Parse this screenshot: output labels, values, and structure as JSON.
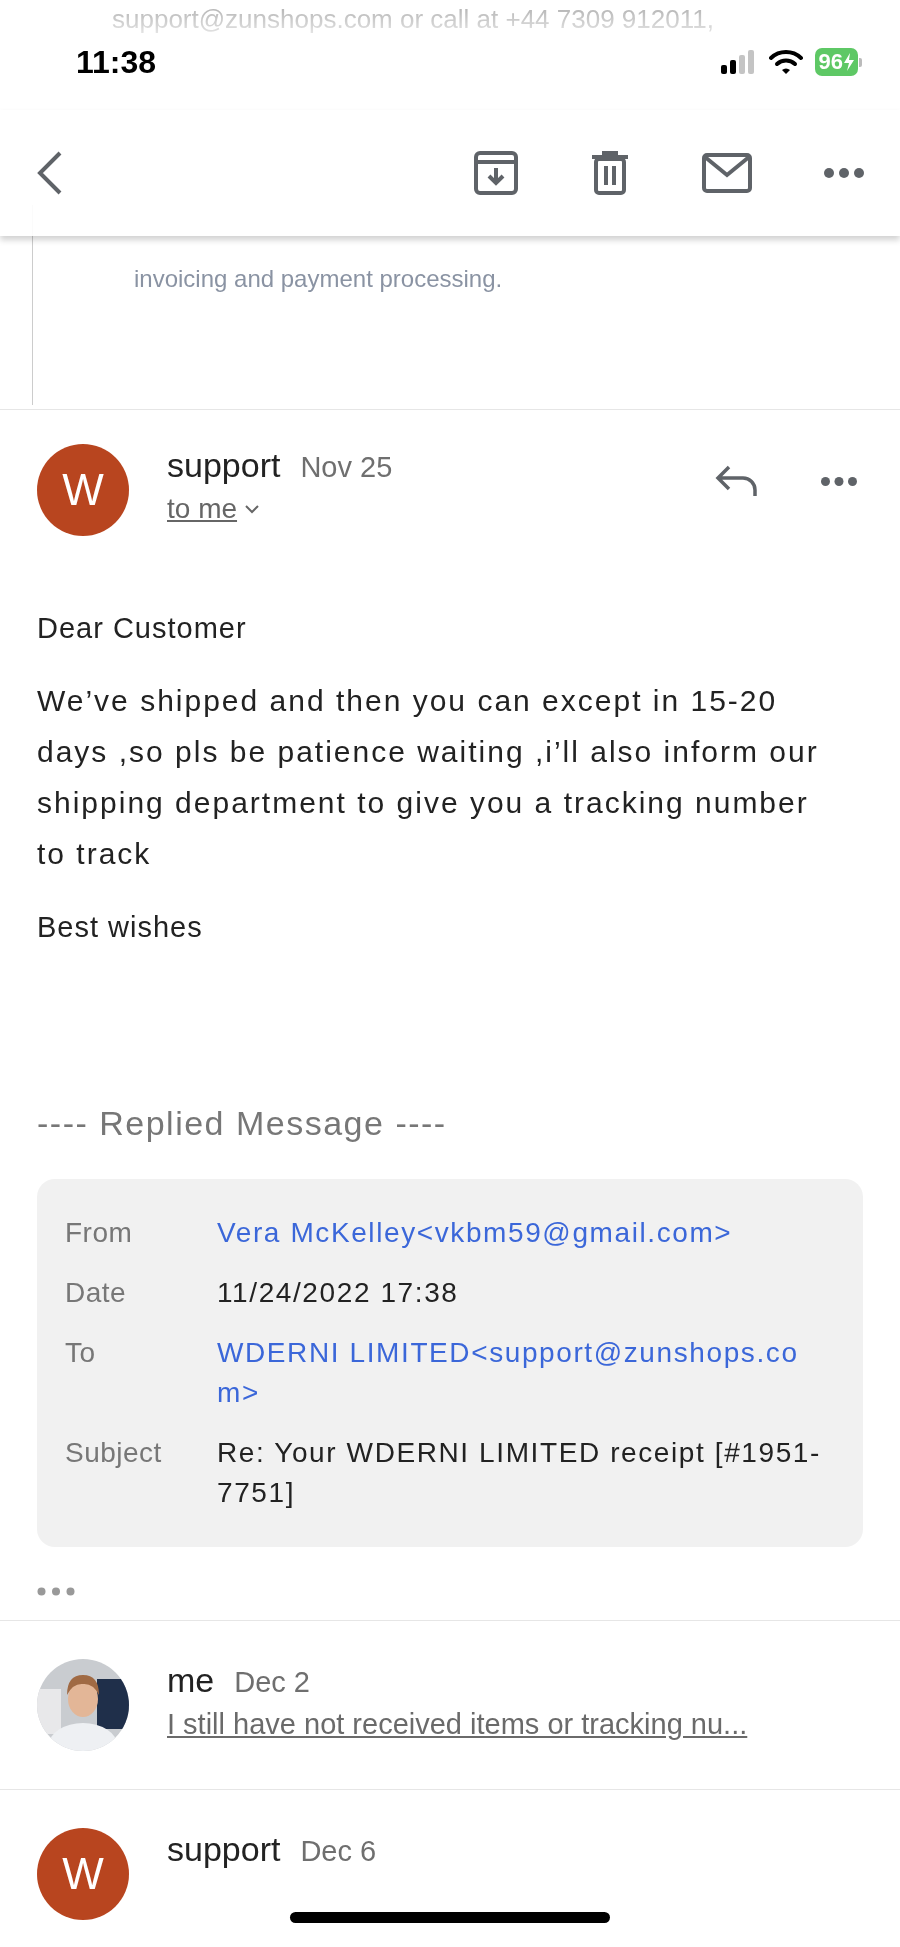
{
  "status_bar": {
    "time": "11:38",
    "battery": "96"
  },
  "quoted_text": [
    "support@zunshops.com or call at +44 7309 912011,",
    "invoicing and payment processing."
  ],
  "message": {
    "avatar_letter": "W",
    "sender": "support",
    "date": "Nov 25",
    "recipient": "to me",
    "greeting": "Dear Customer",
    "body": "We’ve shipped and then you can except in 15-20 days ,so pls be patience waiting ,i’ll also inform our shipping department to give you a tracking number to track",
    "closing": "Best wishes",
    "replied_heading": "---- Replied Message ----",
    "replied_fields": [
      {
        "label": "From",
        "value": "Vera McKelley<vkbm59@gmail.com>",
        "kind": "link"
      },
      {
        "label": "Date",
        "value": "11/24/2022 17:38",
        "kind": "text"
      },
      {
        "label": "To",
        "value": "WDERNI LIMITED<support@zunshops.com>",
        "kind": "link"
      },
      {
        "label": "Subject",
        "value": "Re: Your WDERNI LIMITED receipt [#1951-7751]",
        "kind": "text"
      }
    ]
  },
  "threads": [
    {
      "sender": "me",
      "date": "Dec 2",
      "snippet": "I still have not received items or tracking nu..."
    },
    {
      "kind": "letter",
      "avatar_letter": "W",
      "sender": "support",
      "date": "Dec 6"
    }
  ]
}
